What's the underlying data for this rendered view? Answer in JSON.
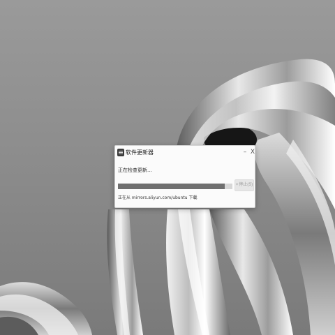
{
  "dialog": {
    "title": "软件更新器",
    "minimize_glyph": "–",
    "close_glyph": "X",
    "status": "正在检查更新...",
    "progress": 0.93,
    "stop_button": {
      "icon_glyph": "×",
      "label": "停止(S)"
    },
    "detail": "正在从 mirrors.aliyun.com/ubuntu 下载"
  },
  "colors": {
    "progress_fill": "#6f6f6f",
    "progress_track": "#d7d7d7"
  }
}
